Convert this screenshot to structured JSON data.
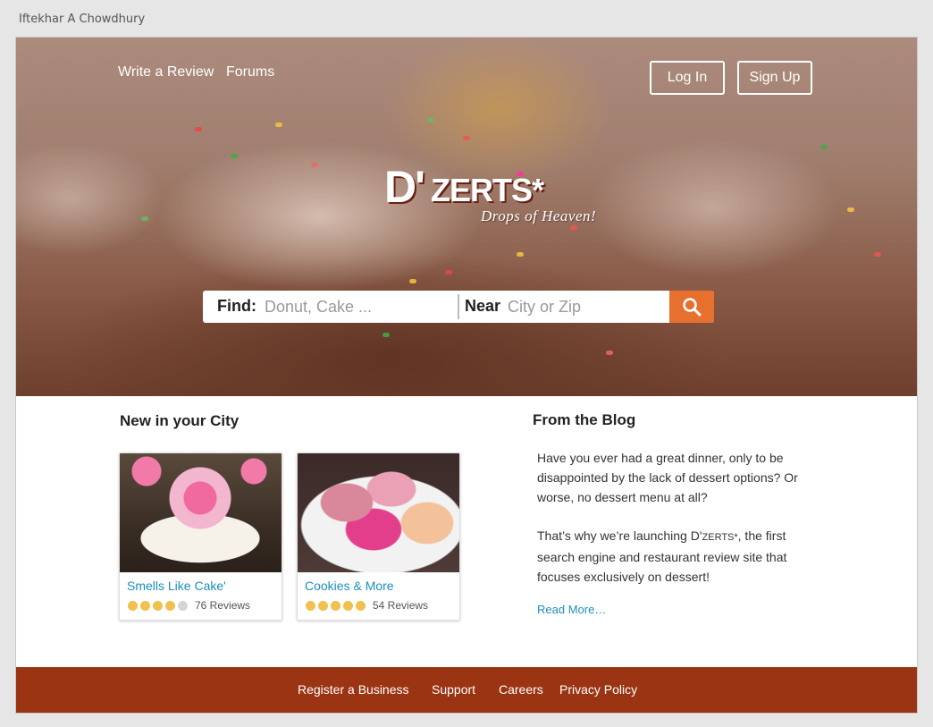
{
  "author": "Iftekhar A Chowdhury",
  "nav": {
    "write_review": "Write a Review",
    "forums": "Forums",
    "login": "Log In",
    "signup": "Sign Up"
  },
  "logo": {
    "d": "D'",
    "zerts": "ZERTS*",
    "tagline": "Drops of Heaven!"
  },
  "search": {
    "find_label": "Find:",
    "find_placeholder": "Donut, Cake ...",
    "near_label": "Near",
    "near_placeholder": "City or Zip",
    "button_icon": "search-icon"
  },
  "new_in_city": {
    "title": "New in your City",
    "cards": [
      {
        "name": "Smells Like Cake'",
        "rating": 4,
        "reviews": "76 Reviews"
      },
      {
        "name": "Cookies & More",
        "rating": 5,
        "reviews": "54 Reviews"
      }
    ]
  },
  "blog": {
    "title": "From the Blog",
    "p1": "Have you ever had a great dinner, only to be disappointed by the lack of dessert options? Or worse, no dessert menu at all?",
    "p2_before": "That’s why we’re launching D'",
    "p2_brand": "ZERTS*",
    "p2_after": ", the first search engine and restaurant review site that focuses exclusively on dessert!",
    "read_more": "Read More…"
  },
  "footer": {
    "register": "Register a Business",
    "support": "Support",
    "careers": "Careers",
    "privacy": "Privacy Policy"
  },
  "colors": {
    "accent": "#e8702e",
    "footer": "#9b3412",
    "link": "#1a8ec0",
    "star": "#f2c04f"
  }
}
